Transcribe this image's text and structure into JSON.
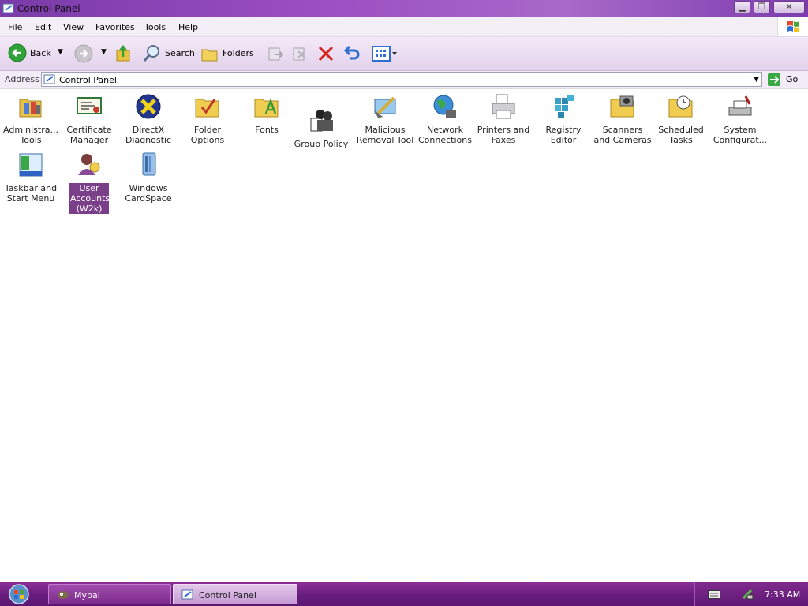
{
  "window": {
    "title": "Control Panel"
  },
  "menubar": {
    "items": [
      "File",
      "Edit",
      "View",
      "Favorites",
      "Tools",
      "Help"
    ]
  },
  "toolbar": {
    "back_label": "Back",
    "search_label": "Search",
    "folders_label": "Folders"
  },
  "address": {
    "label": "Address",
    "value": "Control Panel",
    "go_label": "Go"
  },
  "items": [
    {
      "label": "Administra... Tools",
      "icon": "administrative-tools-icon"
    },
    {
      "label": "Certificate Manager",
      "icon": "certificate-icon"
    },
    {
      "label": "DirectX Diagnostic",
      "icon": "directx-icon"
    },
    {
      "label": "Folder Options",
      "icon": "folder-options-icon"
    },
    {
      "label": "Fonts",
      "icon": "fonts-folder-icon"
    },
    {
      "label": "Group Policy",
      "icon": "group-policy-icon"
    },
    {
      "label": "Malicious Removal Tool",
      "icon": "malicious-removal-icon"
    },
    {
      "label": "Network Connections",
      "icon": "network-globe-icon"
    },
    {
      "label": "Printers and Faxes",
      "icon": "printer-icon"
    },
    {
      "label": "Registry Editor",
      "icon": "registry-icon"
    },
    {
      "label": "Scanners and Cameras",
      "icon": "scanner-icon"
    },
    {
      "label": "Scheduled Tasks",
      "icon": "scheduled-tasks-icon"
    },
    {
      "label": "System Configurat...",
      "icon": "system-config-icon"
    },
    {
      "label": "Taskbar and Start Menu",
      "icon": "taskbar-icon"
    },
    {
      "label": "User Accounts (W2k)",
      "icon": "user-accounts-icon"
    },
    {
      "label": "Windows CardSpace",
      "icon": "cardspace-icon"
    }
  ],
  "taskbar": {
    "tasks": [
      {
        "label": "Mypal"
      },
      {
        "label": "Control Panel"
      }
    ],
    "clock": "7:33 AM"
  }
}
